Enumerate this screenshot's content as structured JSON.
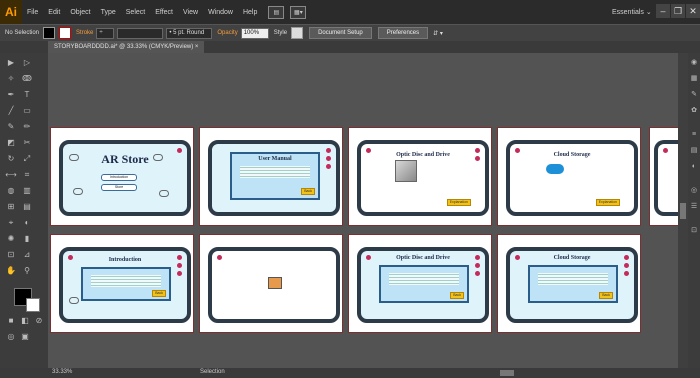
{
  "app": {
    "logo": "Ai"
  },
  "menu": [
    "File",
    "Edit",
    "Object",
    "Type",
    "Select",
    "Effect",
    "View",
    "Window",
    "Help"
  ],
  "menubar_extra": {
    "btn1": "▤",
    "btn2": "▦▾"
  },
  "workspace_label": "Essentials ⌄",
  "window_controls": {
    "minimize": "–",
    "maximize": "❐",
    "close": "✕"
  },
  "control_bar": {
    "selection": "No Selection",
    "stroke_label": "Stroke",
    "stroke_value": "÷",
    "brush": "• 5 pt. Round",
    "opacity_label": "Opacity",
    "opacity_value": "100%",
    "style_label": "Style",
    "document_setup": "Document Setup",
    "preferences": "Preferences",
    "arrange": "⇵ ▾"
  },
  "document_tab": "STORYBOARDDDD.ai* @ 33.33% (CMYK/Preview)  ×",
  "status": {
    "zoom": "33.33%",
    "label": "Selection"
  },
  "colors": {
    "accent": "#ff9a00",
    "artboard_border": "#7a3030",
    "device_frame": "#2d3a48",
    "dot": "#c42a5a",
    "tag": "#f2c218"
  },
  "artboards": [
    {
      "title": "AR Store",
      "pill1": "Introduction",
      "pill2": "Store"
    },
    {
      "title": "User Manual",
      "tag": "Back"
    },
    {
      "title": "Optic Disc and Drive",
      "tag": "Explanation"
    },
    {
      "title": "Cloud Storage",
      "tag": "Explanation"
    },
    {
      "title": ""
    },
    {
      "title": "Introduction",
      "tag": "Back"
    },
    {
      "title": ""
    },
    {
      "title": "Optic Disc and Drive",
      "tag": "Back"
    },
    {
      "title": "Cloud Storage",
      "tag": "Back"
    }
  ]
}
